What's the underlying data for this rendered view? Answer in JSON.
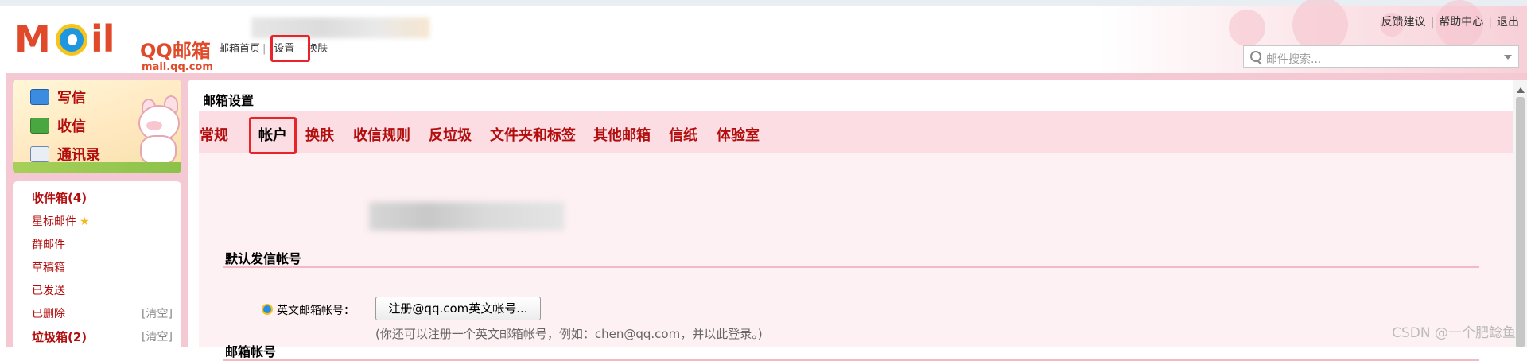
{
  "header": {
    "logo_word": "M",
    "logo_word_tail": "il",
    "logo_cn": "QQ邮箱",
    "logo_sub": "mail.qq.com",
    "nav": [
      {
        "label": "邮箱首页"
      },
      {
        "label": "设置"
      },
      {
        "label": "换肤"
      }
    ],
    "nav_sep": "|",
    "nav_sep2": "-",
    "links": [
      {
        "label": "反馈建议"
      },
      {
        "label": "帮助中心"
      },
      {
        "label": "退出"
      }
    ],
    "link_sep": "|",
    "search": {
      "placeholder": "邮件搜索..."
    }
  },
  "sidebar": {
    "actions": [
      {
        "label": "写信",
        "icon": "pencil-icon"
      },
      {
        "label": "收信",
        "icon": "inbox-download-icon"
      },
      {
        "label": "通讯录",
        "icon": "contact-card-icon"
      }
    ],
    "folders": [
      {
        "label": "收件箱(4)",
        "bold": true
      },
      {
        "label": "星标邮件",
        "star": "★"
      },
      {
        "label": "群邮件"
      },
      {
        "label": "草稿箱"
      },
      {
        "label": "已发送"
      },
      {
        "label": "已删除",
        "action": "[清空]"
      },
      {
        "label": "垃圾箱(2)",
        "bold": true,
        "action": "[清空]"
      }
    ]
  },
  "main": {
    "title": "邮箱设置",
    "tabs": [
      {
        "label": "常规"
      },
      {
        "label": "帐户",
        "active": true
      },
      {
        "label": "换肤"
      },
      {
        "label": "收信规则"
      },
      {
        "label": "反垃圾"
      },
      {
        "label": "文件夹和标签"
      },
      {
        "label": "其他邮箱"
      },
      {
        "label": "信纸"
      },
      {
        "label": "体验室"
      }
    ],
    "sections": {
      "default_sender": {
        "title": "默认发信帐号"
      },
      "mailbox_account": {
        "title": "邮箱帐号",
        "field_label": "英文邮箱帐号：",
        "button": "注册@qq.com英文帐号...",
        "hint": "(你还可以注册一个英文邮箱帐号，例如：chen@qq.com，并以此登录。)"
      }
    }
  },
  "watermark": "CSDN @一个肥鲶鱼",
  "colors": {
    "brand": "#e04a2a",
    "accent_text": "#b30e0e",
    "frame_pink": "#f5c9d3",
    "highlight_box": "#e8242a"
  }
}
